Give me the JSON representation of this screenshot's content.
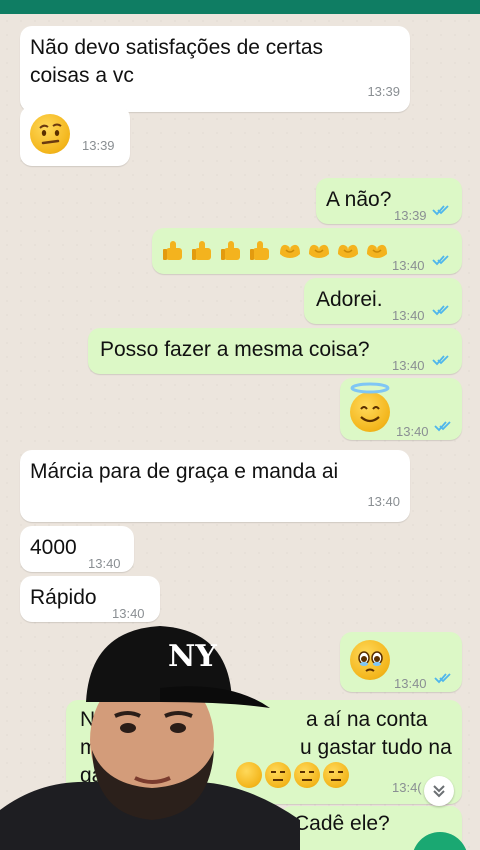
{
  "chat": {
    "messages": [
      {
        "dir": "in",
        "text_lines": [
          "Não devo satisfações de certas",
          "coisas a vc"
        ],
        "time": "13:39"
      },
      {
        "dir": "in",
        "emoji": "raised-eyebrow-face",
        "time": "13:39"
      },
      {
        "dir": "out",
        "text": "A não?",
        "time": "13:39",
        "status": "read"
      },
      {
        "dir": "out",
        "emoji_row": [
          "thumbs-up",
          "thumbs-up",
          "thumbs-up",
          "thumbs-up",
          "heart-hands",
          "heart-hands",
          "heart-hands",
          "heart-hands"
        ],
        "time": "13:40",
        "status": "read"
      },
      {
        "dir": "out",
        "text": "Adorei.",
        "time": "13:40",
        "status": "read"
      },
      {
        "dir": "out",
        "text": "Posso fazer a mesma coisa?",
        "time": "13:40",
        "status": "read"
      },
      {
        "dir": "out",
        "emoji": "smiling-face-with-halo",
        "time": "13:40",
        "status": "read"
      },
      {
        "dir": "in",
        "text": "Márcia para de graça e manda ai",
        "time": "13:40"
      },
      {
        "dir": "in",
        "text": "4000",
        "time": "13:40"
      },
      {
        "dir": "in",
        "text": "Rápido",
        "time": "13:40"
      },
      {
        "dir": "out",
        "emoji": "face-holding-back-tears",
        "time": "13:40",
        "status": "read"
      },
      {
        "dir": "out",
        "text_fragments": [
          "No",
          "a aí na conta",
          "m",
          "u gastar tudo na",
          "gan"
        ],
        "emoji_row": [
          "thinking-face",
          "expressionless-face",
          "expressionless-face",
          "expressionless-face"
        ],
        "time": "13:4("
      },
      {
        "dir": "out",
        "text": "Cadê ele?"
      }
    ]
  },
  "colors": {
    "header": "#0f7d63",
    "background": "#ece5dd",
    "incoming_bubble": "#ffffff",
    "outgoing_bubble": "#dcf8c6",
    "read_ticks": "#4fb6ec",
    "timestamp": "#8a8f93"
  },
  "controls": {
    "scroll_down_icon": "chevron-down-double-icon"
  }
}
